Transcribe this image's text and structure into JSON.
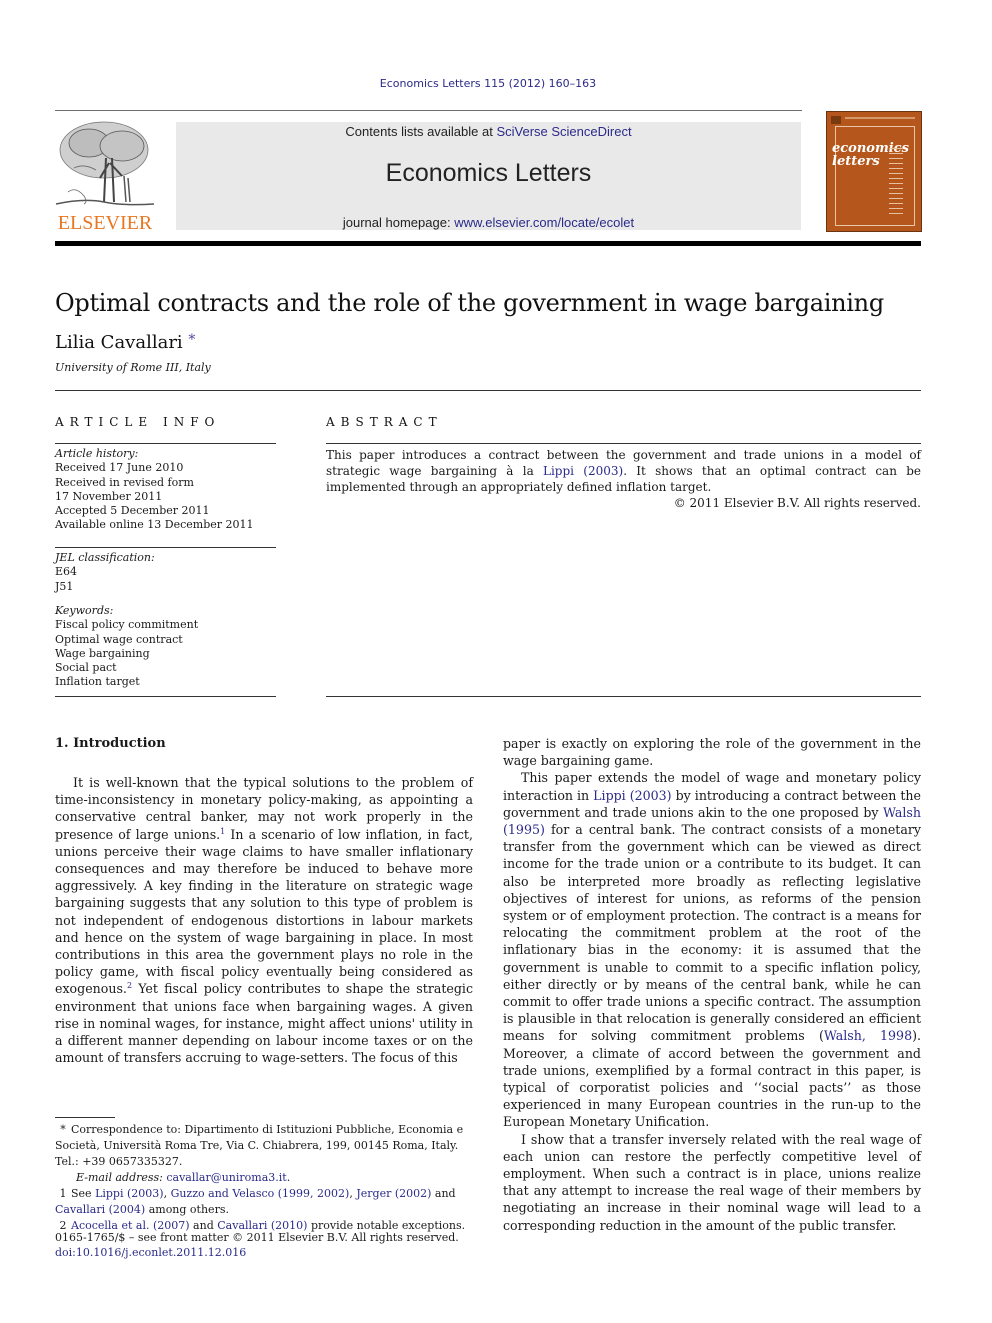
{
  "running_head": "Economics Letters 115 (2012) 160–163",
  "header": {
    "publisher_logo_text": "ELSEVIER",
    "contents_prefix": "Contents lists available at ",
    "contents_link": "SciVerse ScienceDirect",
    "journal_title": "Economics Letters",
    "homepage_prefix": "journal homepage: ",
    "homepage_link": "www.elsevier.com/locate/ecolet",
    "cover_title_line1": "economics",
    "cover_title_line2": "letters"
  },
  "article": {
    "title": "Optimal contracts and the role of the government in wage bargaining",
    "author": "Lilia Cavallari",
    "author_mark": "*",
    "affiliation": "University of Rome III, Italy"
  },
  "article_info": {
    "label": "ARTICLE INFO",
    "history_head": "Article history:",
    "history": [
      "Received 17 June 2010",
      "Received in revised form",
      "17 November 2011",
      "Accepted 5 December 2011",
      "Available online 13 December 2011"
    ],
    "jel_head": "JEL classification:",
    "jel": [
      "E64",
      "J51"
    ],
    "keywords_head": "Keywords:",
    "keywords": [
      "Fiscal policy commitment",
      "Optimal wage contract",
      "Wage bargaining",
      "Social pact",
      "Inflation target"
    ]
  },
  "abstract": {
    "label": "ABSTRACT",
    "text_before_link": "This paper introduces a contract between the government and trade unions in a model of strategic wage bargaining à la ",
    "link": "Lippi (2003)",
    "text_after_link": ". It shows that an optimal contract can be implemented through an appropriately defined inflation target.",
    "copyright": "© 2011 Elsevier B.V. All rights reserved."
  },
  "introduction": {
    "heading": "1.  Introduction",
    "left_p1_a": "It is well-known that the typical solutions to the problem of time-inconsistency in monetary policy-making, as appointing a conservative central banker, may not work properly in the presence of large unions.",
    "left_p1_sup1": "1",
    "left_p1_b": " In a scenario of low inflation, in fact, unions perceive their wage claims to have smaller inflationary consequences and may therefore be induced to behave more aggressively. A key finding in the literature on strategic wage bargaining suggests that any solution to this type of problem is not independent of endogenous distortions in labour markets and hence on the system of wage bargaining in place. In most contributions in this area the government plays no role in the policy game, with fiscal policy eventually being considered as exogenous.",
    "left_p1_sup2": "2",
    "left_p1_c": " Yet fiscal policy contributes to shape the strategic environment that unions face when bargaining wages. A given rise in nominal wages, for instance, might affect unions' utility in a different manner depending on labour income taxes or on the amount of transfers accruing to wage-setters. The focus of this",
    "right_p1": "paper is exactly on exploring the role of the government in the wage bargaining game.",
    "right_p2_a": "This paper extends the model of wage and monetary policy interaction in ",
    "right_p2_link1": "Lippi (2003)",
    "right_p2_b": " by introducing a contract between the government and trade unions akin to the one proposed by ",
    "right_p2_link2": "Walsh (1995)",
    "right_p2_c": " for a central bank. The contract consists of a monetary transfer from the government which can be viewed as direct income for the trade union or a contribute to its budget. It can also be interpreted more broadly as reflecting legislative objectives of interest for unions, as reforms of the pension system or of employment protection. The contract is a means for relocating the commitment problem at the root of the inflationary bias in the economy: it is assumed that the government is unable to commit to a specific inflation policy, either directly or by means of the central bank, while he can commit to offer trade unions a specific contract. The assumption is plausible in that relocation is generally considered an efficient means for solving commitment problems (",
    "right_p2_link3": "Walsh, 1998",
    "right_p2_d": "). Moreover, a climate of accord between the government and trade unions, exemplified by a formal contract in this paper, is typical of corporatist policies and ‘‘social pacts’’ as those experienced in many European countries in the run-up to the European Monetary Unification.",
    "right_p3": "I show that a transfer inversely related with the real wage of each union can restore the perfectly competitive level of employment. When such a contract is in place, unions realize that any attempt to increase the real wage of their members by negotiating an increase in their nominal wage will lead to a corresponding reduction in the amount of the public transfer."
  },
  "footnotes": {
    "star_mark": "*",
    "star_text": "Correspondence to: Dipartimento di Istituzioni Pubbliche, Economia e Società, Università Roma Tre, Via C. Chiabrera, 199, 00145 Roma, Italy. Tel.: +39 0657335327.",
    "email_label": "E-mail address: ",
    "email": "cavallar@uniroma3.it",
    "email_end": ".",
    "fn1_mark": "1",
    "fn1_pre": "See ",
    "fn1_l1": "Lippi (2003)",
    "fn1_s1": ", ",
    "fn1_l2": "Guzzo and Velasco (1999, 2002)",
    "fn1_s2": ", ",
    "fn1_l3": "Jerger (2002)",
    "fn1_s3": " and ",
    "fn1_l4": "Cavallari (2004)",
    "fn1_end": " among others.",
    "fn2_mark": "2",
    "fn2_l1": "Acocella et al. (2007)",
    "fn2_s1": " and ",
    "fn2_l2": "Cavallari (2010)",
    "fn2_end": " provide notable exceptions."
  },
  "front_matter": {
    "issn_line": "0165-1765/$ – see front matter © 2011 Elsevier B.V. All rights reserved.",
    "doi": "doi:10.1016/j.econlet.2011.12.016"
  },
  "colors": {
    "link": "#2a2a8a",
    "elsevier_orange": "#e87722",
    "cover_brown": "#b5571c",
    "banner_gray": "#e9e9e9"
  }
}
